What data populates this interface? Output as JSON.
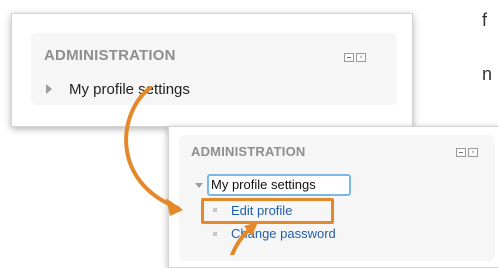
{
  "panel_before": {
    "title": "ADMINISTRATION",
    "tree_item": "My profile settings"
  },
  "panel_after": {
    "title": "ADMINISTRATION",
    "tree_item": "My profile settings",
    "children": [
      "Edit profile",
      "Change password"
    ]
  },
  "block_controls": {
    "hide_icon": "minimize-icon",
    "dock_icon": "dock-icon",
    "dock_glyph": "‹"
  },
  "colors": {
    "callout_orange": "#e4892a",
    "link_blue": "#1f5fa9",
    "selection_blue": "#7cb7e6",
    "title_gray": "#8e8e8e"
  },
  "side_text": {
    "line1": "f",
    "line2": "n"
  }
}
